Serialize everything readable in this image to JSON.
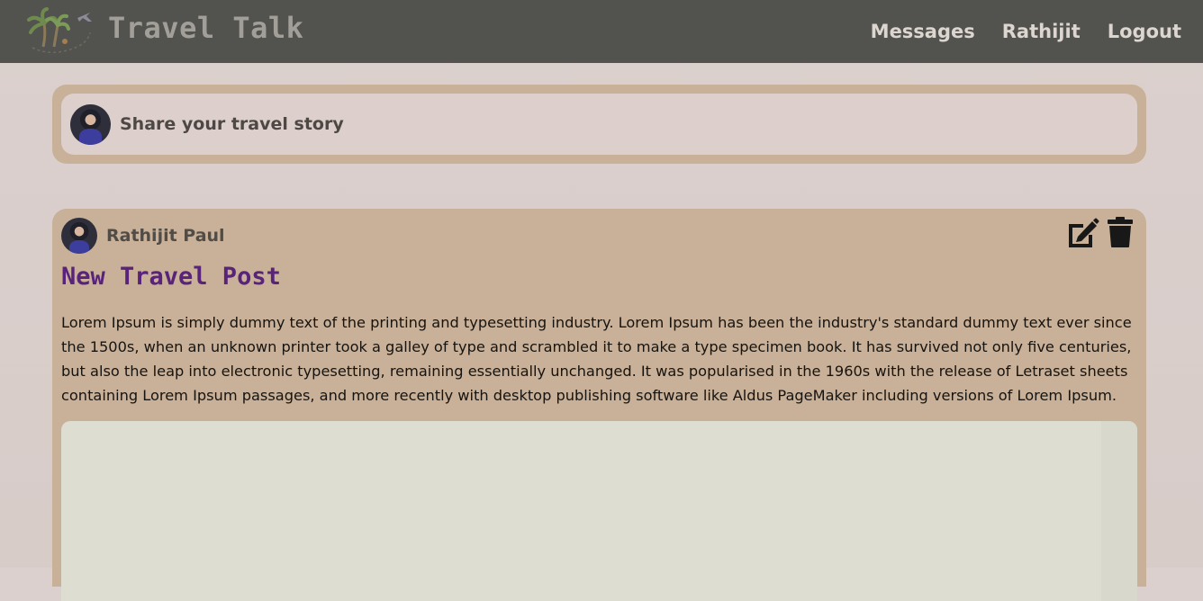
{
  "header": {
    "brand": "Travel Talk",
    "nav": [
      "Messages",
      "Rathijit",
      "Logout"
    ]
  },
  "composer": {
    "prompt": "Share your travel story"
  },
  "post": {
    "author": "Rathijit Paul",
    "title": "New Travel Post",
    "body": "Lorem Ipsum is simply dummy text of the printing and typesetting industry. Lorem Ipsum has been the industry's standard dummy text ever since the 1500s, when an unknown printer took a galley of type and scrambled it to make a type specimen book. It has survived not only five centuries, but also the leap into electronic typesetting, remaining essentially unchanged. It was popularised in the 1960s with the release of Letraset sheets containing Lorem Ipsum passages, and more recently with desktop publishing software like Aldus PageMaker including versions of Lorem Ipsum."
  },
  "icons": {
    "logo": "palm-tree-airplane-logo",
    "edit": "edit-icon",
    "delete": "trash-icon"
  },
  "colors": {
    "topbar": "#52524e",
    "card": "#c8b198",
    "title": "#5a237a"
  }
}
